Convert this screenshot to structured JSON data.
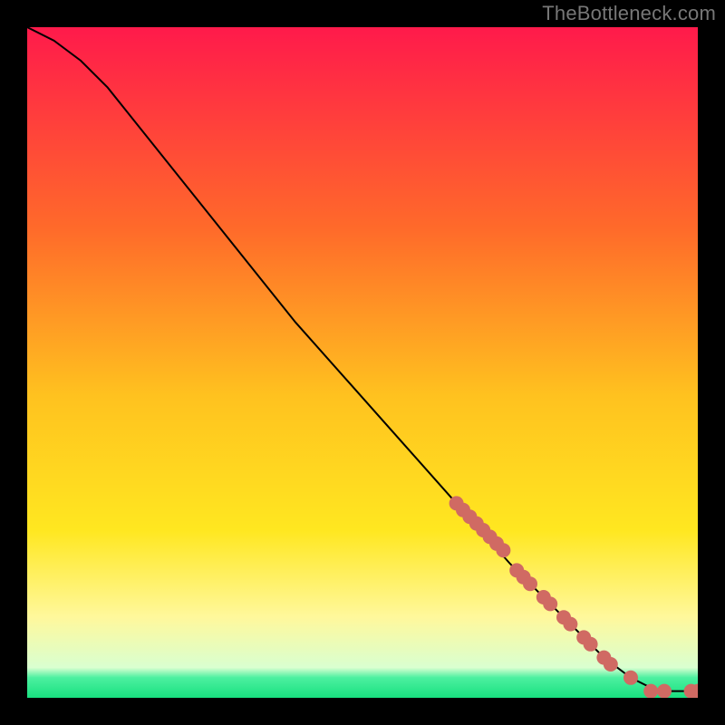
{
  "attribution": "TheBottleneck.com",
  "colors": {
    "frame": "#000000",
    "attribution_text": "#777777",
    "curve": "#000000",
    "dot": "#d06a63",
    "grad_top": "#ff1a4b",
    "grad_mid_upper": "#ff9a1f",
    "grad_mid": "#ffe720",
    "grad_low_yellow": "#fff89c",
    "grad_bottom": "#18e07f"
  },
  "chart_data": {
    "type": "line",
    "title": "",
    "xlabel": "",
    "ylabel": "",
    "xlim": [
      0,
      100
    ],
    "ylim": [
      0,
      100
    ],
    "grid": false,
    "legend": false,
    "gradient_stops": [
      {
        "offset": 0.0,
        "color": "#ff1a4b"
      },
      {
        "offset": 0.3,
        "color": "#ff6a2a"
      },
      {
        "offset": 0.55,
        "color": "#ffc21f"
      },
      {
        "offset": 0.75,
        "color": "#ffe720"
      },
      {
        "offset": 0.88,
        "color": "#fff89c"
      },
      {
        "offset": 0.955,
        "color": "#d9ffd0"
      },
      {
        "offset": 0.97,
        "color": "#4cf0a0"
      },
      {
        "offset": 1.0,
        "color": "#18e07f"
      }
    ],
    "series": [
      {
        "name": "trend",
        "x": [
          0,
          4,
          8,
          12,
          16,
          24,
          32,
          40,
          48,
          56,
          64,
          72,
          80,
          86,
          90,
          94,
          98,
          100
        ],
        "y": [
          100,
          98,
          95,
          91,
          86,
          76,
          66,
          56,
          47,
          38,
          29,
          20,
          12,
          6,
          3,
          1,
          1,
          1
        ]
      }
    ],
    "points": [
      {
        "x": 64,
        "y": 29
      },
      {
        "x": 65,
        "y": 28
      },
      {
        "x": 66,
        "y": 27
      },
      {
        "x": 67,
        "y": 26
      },
      {
        "x": 68,
        "y": 25
      },
      {
        "x": 69,
        "y": 24
      },
      {
        "x": 70,
        "y": 23
      },
      {
        "x": 71,
        "y": 22
      },
      {
        "x": 73,
        "y": 19
      },
      {
        "x": 74,
        "y": 18
      },
      {
        "x": 75,
        "y": 17
      },
      {
        "x": 77,
        "y": 15
      },
      {
        "x": 78,
        "y": 14
      },
      {
        "x": 80,
        "y": 12
      },
      {
        "x": 81,
        "y": 11
      },
      {
        "x": 83,
        "y": 9
      },
      {
        "x": 84,
        "y": 8
      },
      {
        "x": 86,
        "y": 6
      },
      {
        "x": 87,
        "y": 5
      },
      {
        "x": 90,
        "y": 3
      },
      {
        "x": 93,
        "y": 1
      },
      {
        "x": 95,
        "y": 1
      },
      {
        "x": 99,
        "y": 1
      },
      {
        "x": 100,
        "y": 1
      }
    ]
  }
}
